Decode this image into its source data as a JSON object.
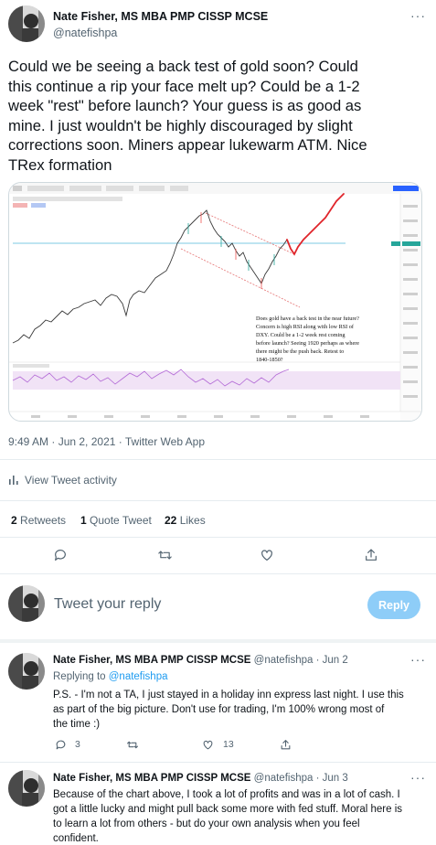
{
  "main_tweet": {
    "author_name": "Nate Fisher, MS MBA PMP CISSP MCSE",
    "handle": "@natefishpa",
    "text_lines": [
      "Could we be seeing a back test of gold soon? Could",
      "this continue a rip your face melt up? Could be a 1-2",
      "week \"rest\" before launch?  Your guess is as good as",
      "mine.  I just wouldn't be highly discouraged by slight",
      "corrections soon.  Miners appear lukewarm ATM. Nice",
      "TRex formation"
    ],
    "chart_annotation_lines": [
      "Does gold have a back test in the near future?",
      "Concern is high RSI along with low RSI of",
      "DXY.  Could be a 1-2 week rest coming",
      "before launch?  Seeing 1920 perhaps as where",
      "there might be the push back.  Retest to",
      "1840-1850?"
    ],
    "timestamp": "9:49 AM · Jun 2, 2021 · Twitter Web App",
    "activity_label": "View Tweet activity",
    "retweets_count": "2",
    "retweets_label": "Retweets",
    "quotes_count": "1",
    "quotes_label": "Quote Tweet",
    "likes_count": "22",
    "likes_label": "Likes"
  },
  "compose": {
    "placeholder": "Tweet your reply",
    "button_label": "Reply"
  },
  "replies": [
    {
      "author_name": "Nate Fisher, MS MBA PMP CISSP MCSE",
      "handle": "@natefishpa",
      "date": "· Jun 2",
      "replying_prefix": "Replying to",
      "replying_handle": "@natefishpa",
      "text_lines": [
        "P.S. - I'm not a TA, I just stayed in a holiday inn express last night.  I use this",
        "as part of the big picture.  Don't use for trading, I'm 100% wrong most of",
        "the time :)"
      ],
      "reply_count": "3",
      "like_count": "13"
    },
    {
      "author_name": "Nate Fisher, MS MBA PMP CISSP MCSE",
      "handle": "@natefishpa",
      "date": "· Jun 3",
      "text_lines": [
        "Because of the chart above, I took a lot of profits and was in a lot of cash. I",
        "got a little lucky and might pull back some more with fed stuff. Moral here is",
        "to learn a lot from others - but do your own analysis when you feel",
        "confident."
      ]
    }
  ],
  "colors": {
    "accent": "#1d9bf0",
    "reply_button_disabled": "#8ecdf8",
    "price_line": "#3a3a3a",
    "projection": "#e0252b",
    "channel": "#e57373",
    "rsi_band": "#f1e3f6",
    "rsi_line": "#b36ad6"
  },
  "icons": [
    "more-icon",
    "reply-icon",
    "retweet-icon",
    "like-icon",
    "share-icon",
    "activity-icon"
  ]
}
